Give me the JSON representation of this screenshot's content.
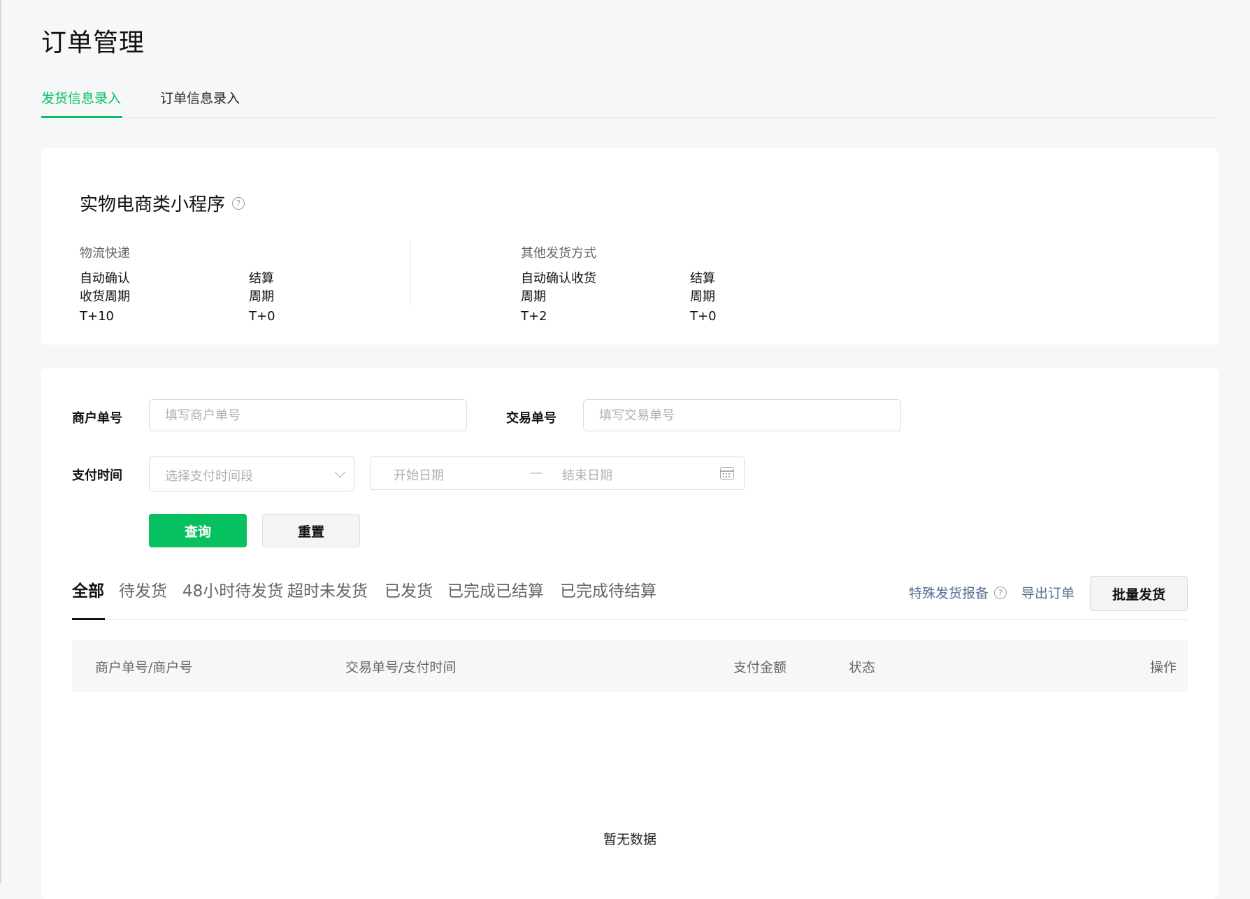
{
  "page": {
    "title": "订单管理"
  },
  "top_tabs": [
    {
      "label": "发货信息录入",
      "active": true
    },
    {
      "label": "订单信息录入",
      "active": false
    }
  ],
  "info_card": {
    "title": "实物电商类小程序",
    "help_icon": "question-circle-icon",
    "groups": [
      {
        "label": "物流快递",
        "metrics": [
          {
            "label": "自动确认收货周期",
            "value": "T+10"
          },
          {
            "label": "结算周期",
            "value": "T+0"
          }
        ]
      },
      {
        "label": "其他发货方式",
        "metrics": [
          {
            "label": "自动确认收货周期",
            "value": "T+2"
          },
          {
            "label": "结算周期",
            "value": "T+0"
          }
        ]
      }
    ]
  },
  "filters": {
    "merchant_no": {
      "label": "商户单号",
      "placeholder": "填写商户单号",
      "value": ""
    },
    "trade_no": {
      "label": "交易单号",
      "placeholder": "填写交易单号",
      "value": ""
    },
    "pay_time": {
      "label": "支付时间",
      "select_placeholder": "选择支付时间段",
      "start_placeholder": "开始日期",
      "separator": "—",
      "end_placeholder": "结束日期"
    },
    "query_label": "查询",
    "reset_label": "重置"
  },
  "status_tabs": [
    {
      "label": "全部",
      "active": true
    },
    {
      "label": "待发货",
      "active": false
    },
    {
      "label": "48小时待发货",
      "active": false
    },
    {
      "label": "超时未发货",
      "active": false
    },
    {
      "label": "已发货",
      "active": false
    },
    {
      "label": "已完成已结算",
      "active": false
    },
    {
      "label": "已完成待结算",
      "active": false
    }
  ],
  "actions": {
    "special_report": "特殊发货报备",
    "export": "导出订单",
    "batch_ship": "批量发货"
  },
  "table": {
    "columns": [
      "商户单号/商户号",
      "交易单号/支付时间",
      "支付金额",
      "状态",
      "操作"
    ],
    "empty_text": "暂无数据"
  },
  "colors": {
    "accent": "#07c160",
    "link": "#576b95"
  }
}
